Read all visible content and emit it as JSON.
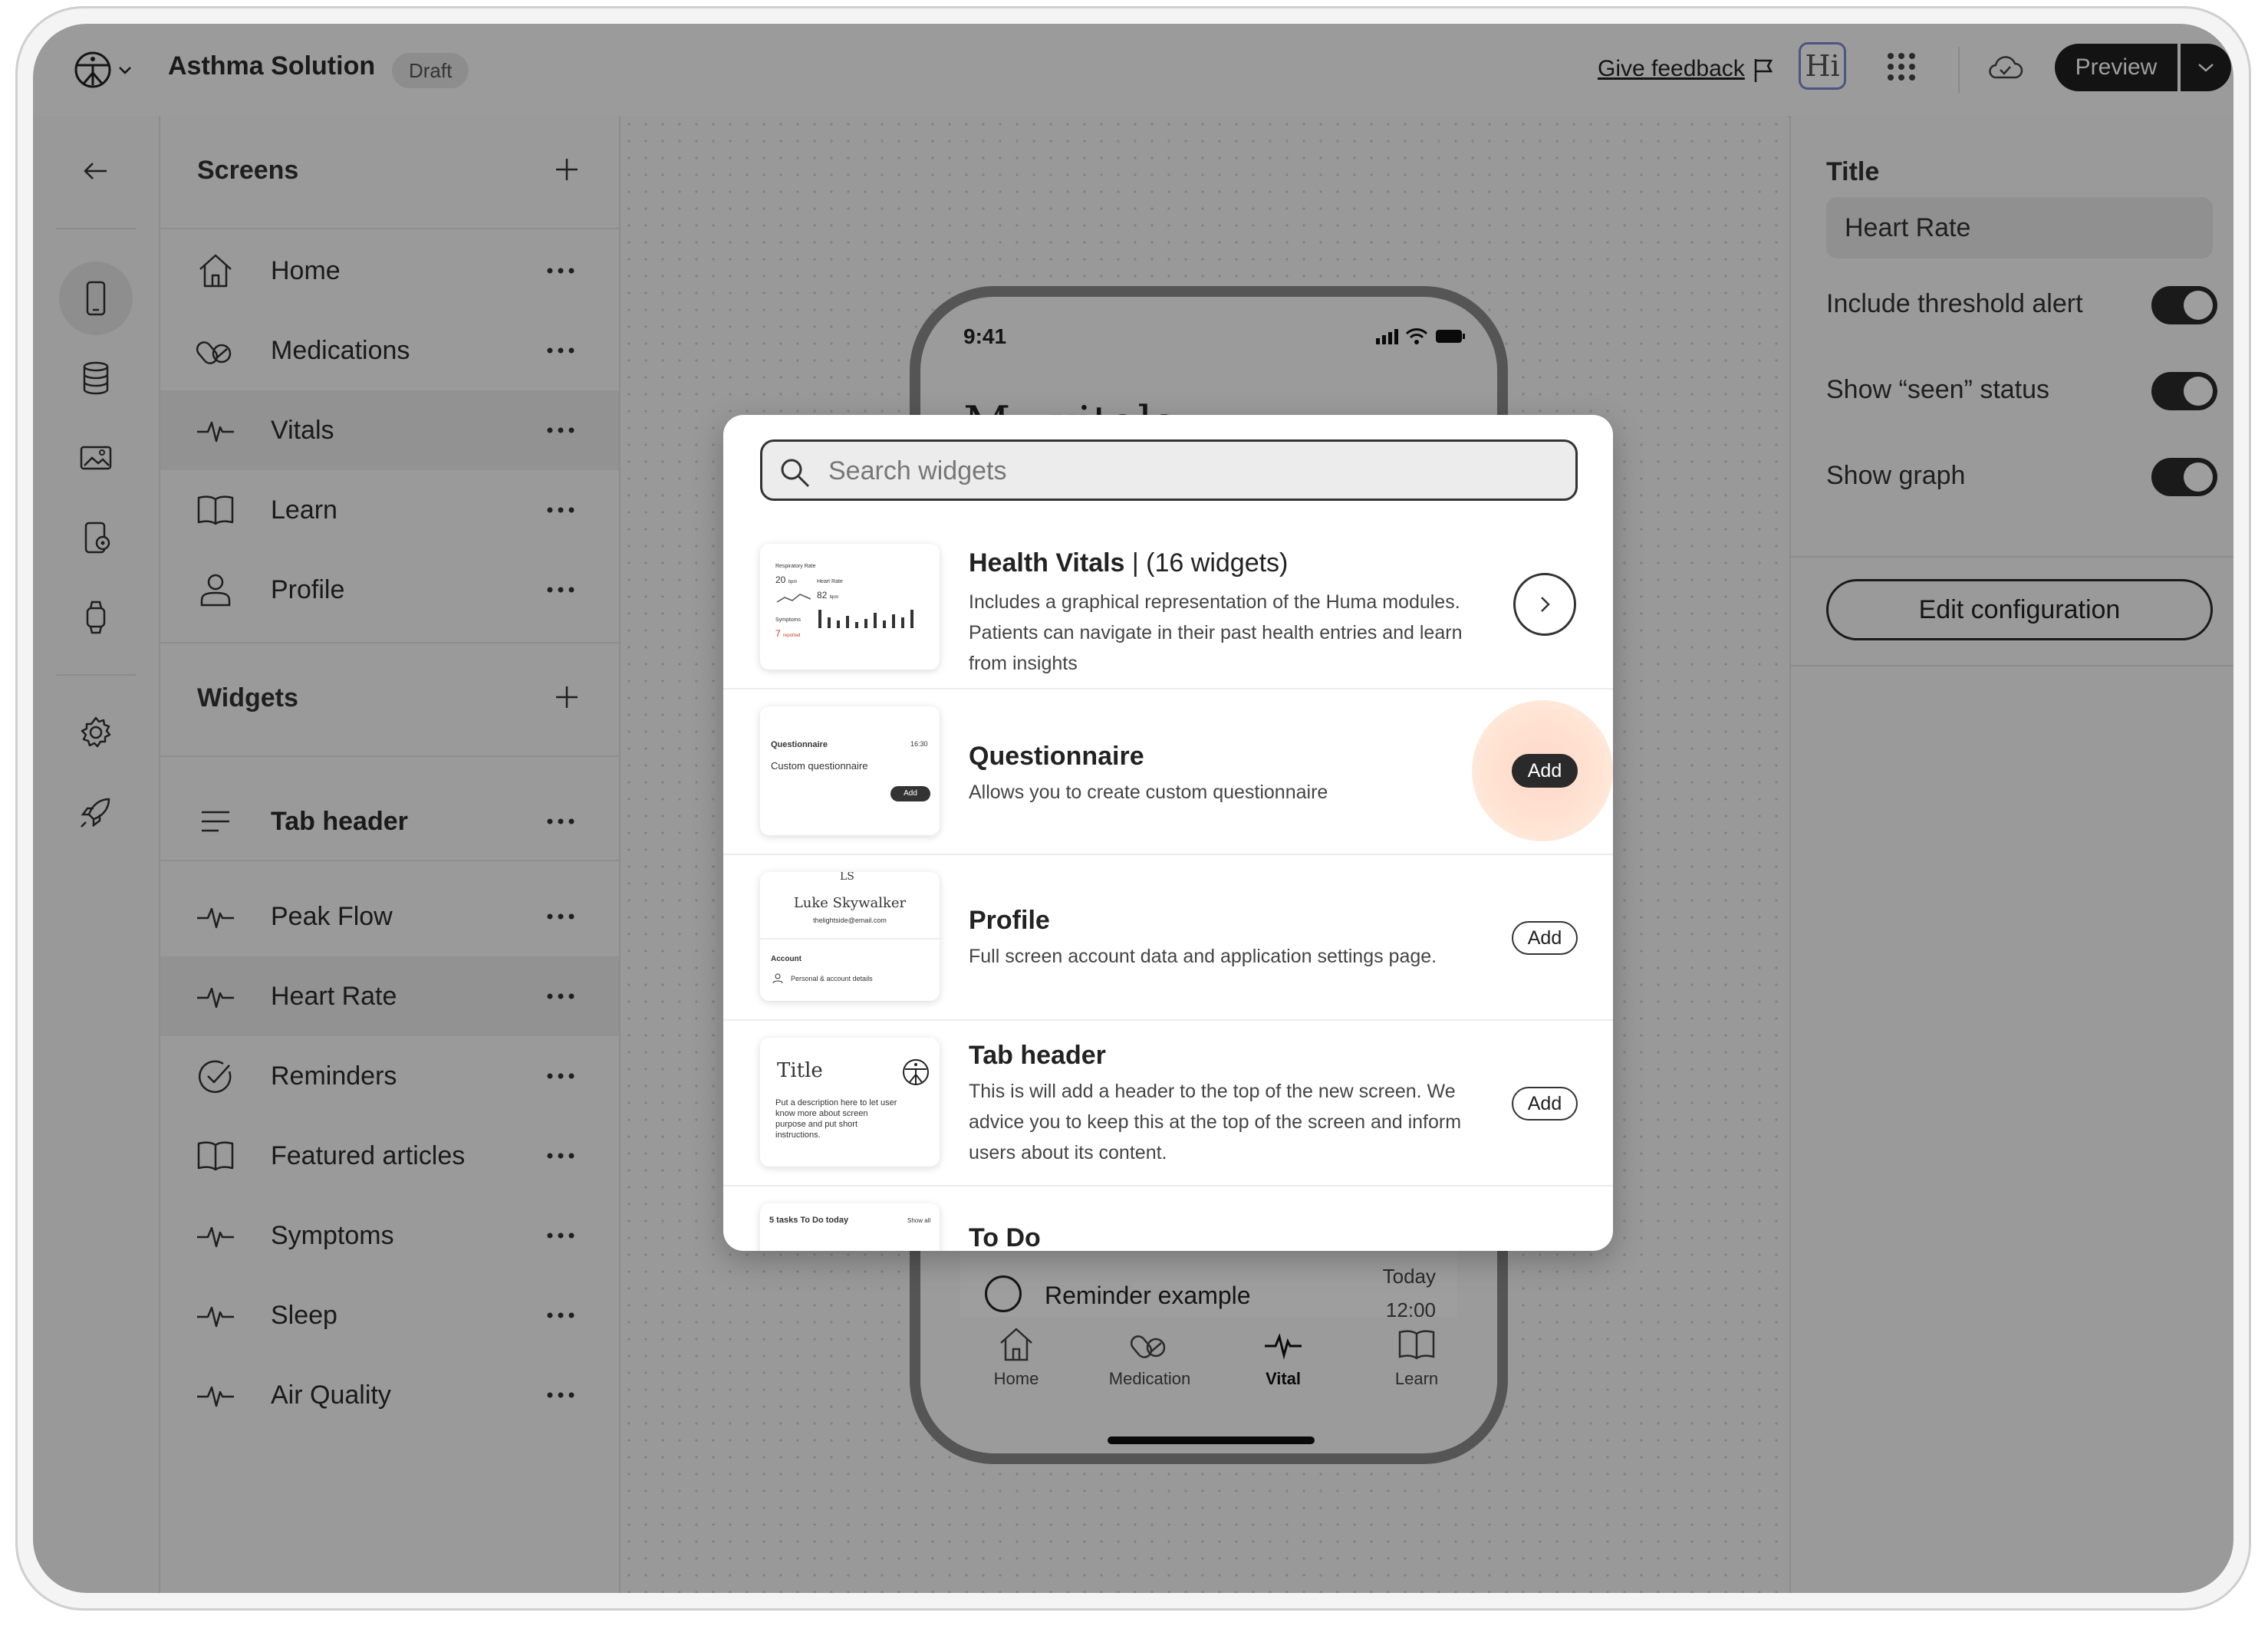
{
  "app": {
    "title": "Asthma Solution",
    "status_badge": "Draft",
    "feedback_link": "Give feedback",
    "avatar_text": "Hi",
    "preview_label": "Preview"
  },
  "screens_panel": {
    "header": "Screens",
    "items": [
      {
        "label": "Home",
        "icon": "home-icon"
      },
      {
        "label": "Medications",
        "icon": "pills-icon"
      },
      {
        "label": "Vitals",
        "icon": "pulse-icon"
      },
      {
        "label": "Learn",
        "icon": "book-icon"
      },
      {
        "label": "Profile",
        "icon": "user-icon"
      }
    ]
  },
  "widgets_panel": {
    "header": "Widgets",
    "tab_header": "Tab header",
    "items": [
      {
        "label": "Peak Flow",
        "icon": "pulse-icon"
      },
      {
        "label": "Heart Rate",
        "icon": "pulse-icon"
      },
      {
        "label": "Reminders",
        "icon": "check-circle-icon"
      },
      {
        "label": "Featured articles",
        "icon": "book-icon"
      },
      {
        "label": "Symptoms",
        "icon": "pulse-icon"
      },
      {
        "label": "Sleep",
        "icon": "pulse-icon"
      },
      {
        "label": "Air Quality",
        "icon": "pulse-icon"
      }
    ]
  },
  "phone": {
    "time": "9:41",
    "heading": "My vitals",
    "reminder_text": "Reminder example",
    "reminder_day": "Today",
    "reminder_time": "12:00",
    "nav": [
      {
        "label": "Home",
        "icon": "home-icon"
      },
      {
        "label": "Medication",
        "icon": "pills-icon"
      },
      {
        "label": "Vital",
        "icon": "pulse-icon"
      },
      {
        "label": "Learn",
        "icon": "book-icon"
      }
    ]
  },
  "properties": {
    "title_label": "Title",
    "title_value": "Heart Rate",
    "toggles": [
      {
        "label": "Include threshold alert",
        "on": true
      },
      {
        "label": "Show “seen” status",
        "on": true
      },
      {
        "label": "Show graph",
        "on": true
      }
    ],
    "edit_button": "Edit configuration"
  },
  "modal": {
    "search_placeholder": "Search widgets",
    "widgets": [
      {
        "name": "Health Vitals",
        "count": "| (16 widgets)",
        "description": "Includes a graphical representation of the Huma modules. Patients can navigate in their past health entries and learn from insights",
        "action": "chevron"
      },
      {
        "name": "Questionnaire",
        "description": "Allows you to create custom questionnaire",
        "action": "Add"
      },
      {
        "name": "Profile",
        "description": "Full screen account data and application settings page.",
        "action": "Add"
      },
      {
        "name": "Tab header",
        "description": "This is will add a header to the top of the new screen. We advice you to keep this at the top of the screen and inform users about its content.",
        "action": "Add"
      },
      {
        "name": "To Do",
        "description": "",
        "action": ""
      }
    ],
    "thumbs": {
      "vitals": {
        "respiratory": "Respiratory Rate",
        "resp_value": "20",
        "resp_unit": "bpm",
        "heart": "Heart Rate",
        "heart_value": "82",
        "heart_unit": "bpm",
        "symptoms": "Symptoms",
        "symptoms_value": "7",
        "symptoms_unit": "reported"
      },
      "questionnaire": {
        "title": "Questionnaire",
        "time": "16:30",
        "subtitle": "Custom questionnaire",
        "add": "Add"
      },
      "profile": {
        "initials": "LS",
        "name": "Luke Skywalker",
        "email": "thelightside@email.com",
        "account": "Account",
        "details": "Personal & account details"
      },
      "tabheader": {
        "title": "Title",
        "desc": "Put a description here to let user know more about screen purpose and put short instructions."
      },
      "todo": {
        "title": "5 tasks To Do today",
        "show_all": "Show all"
      }
    }
  },
  "colors": {
    "accent_dark": "#1f1f1f",
    "avatar_border": "#7a8bd1",
    "add_glow": "#ffd7c8"
  }
}
